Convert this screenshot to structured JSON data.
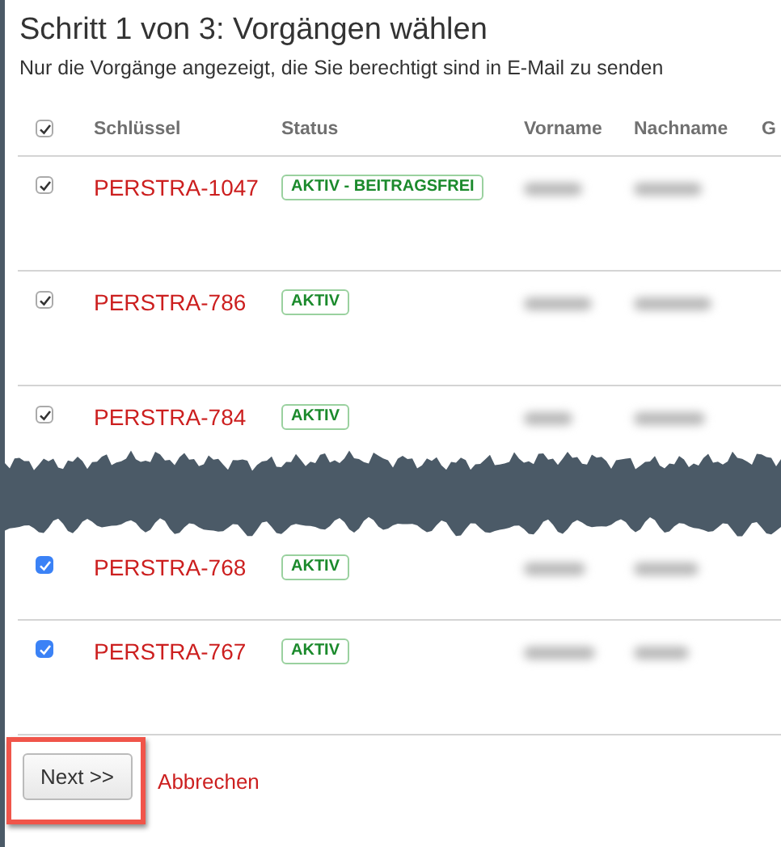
{
  "title": "Schritt 1 von 3: Vorgängen wählen",
  "subtitle": "Nur die Vorgänge angezeigt, die Sie berechtigt sind in E-Mail zu senden",
  "table": {
    "select_all": {
      "checked": true
    },
    "columns": [
      "Schlüssel",
      "Status",
      "Vorname",
      "Nachname",
      "G"
    ],
    "sections": [
      {
        "rows": [
          {
            "checked": true,
            "kind": "plain",
            "key": "PERSTRA-1047",
            "status": "AKTIV - BEITRAGSFREI",
            "names_blurred": true
          },
          {
            "checked": true,
            "kind": "plain",
            "key": "PERSTRA-786",
            "status": "AKTIV",
            "names_blurred": true
          },
          {
            "checked": true,
            "kind": "plain",
            "key": "PERSTRA-784",
            "status": "AKTIV",
            "names_blurred": true
          }
        ]
      },
      {
        "rows": [
          {
            "checked": true,
            "kind": "accent",
            "key": "PERSTRA-768",
            "status": "AKTIV",
            "names_blurred": true
          },
          {
            "checked": true,
            "kind": "accent",
            "key": "PERSTRA-767",
            "status": "AKTIV",
            "names_blurred": true
          }
        ]
      }
    ]
  },
  "buttons": {
    "next": {
      "label": "Next >>",
      "highlighted": true
    },
    "cancel": {
      "label": "Abbrechen"
    }
  }
}
